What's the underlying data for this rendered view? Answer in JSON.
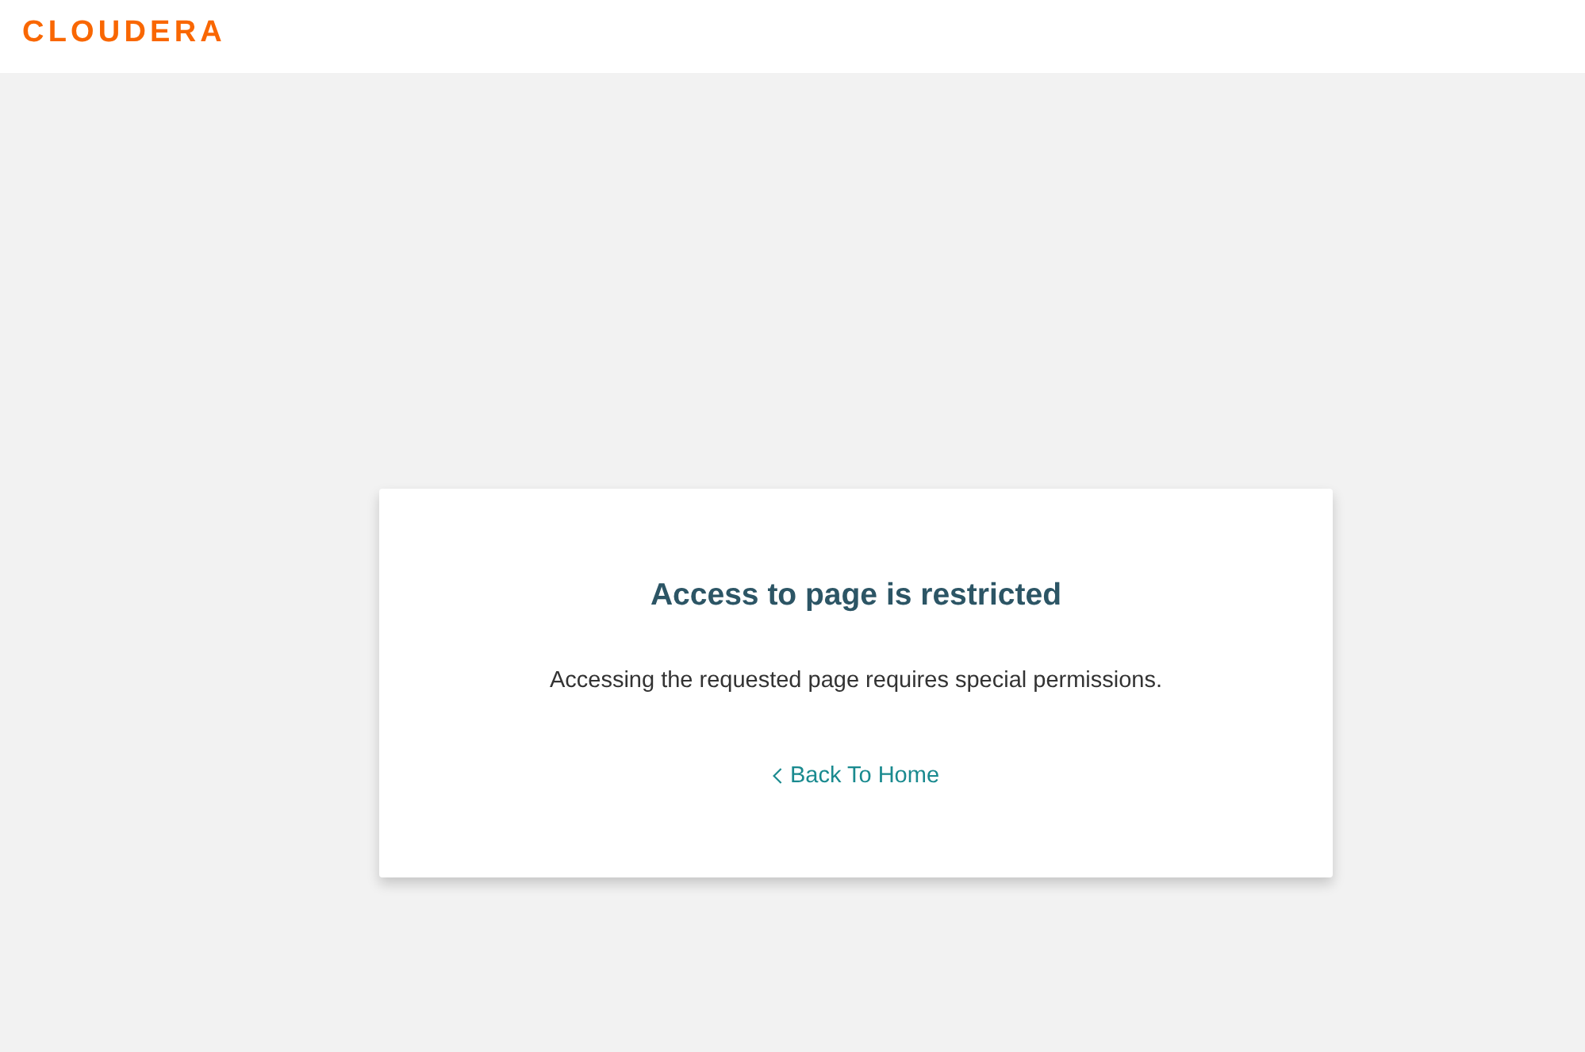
{
  "header": {
    "logo": "CLOUDERA"
  },
  "card": {
    "title": "Access to page is restricted",
    "message": "Accessing the requested page requires special permissions.",
    "link": {
      "label": "Back To Home"
    }
  }
}
